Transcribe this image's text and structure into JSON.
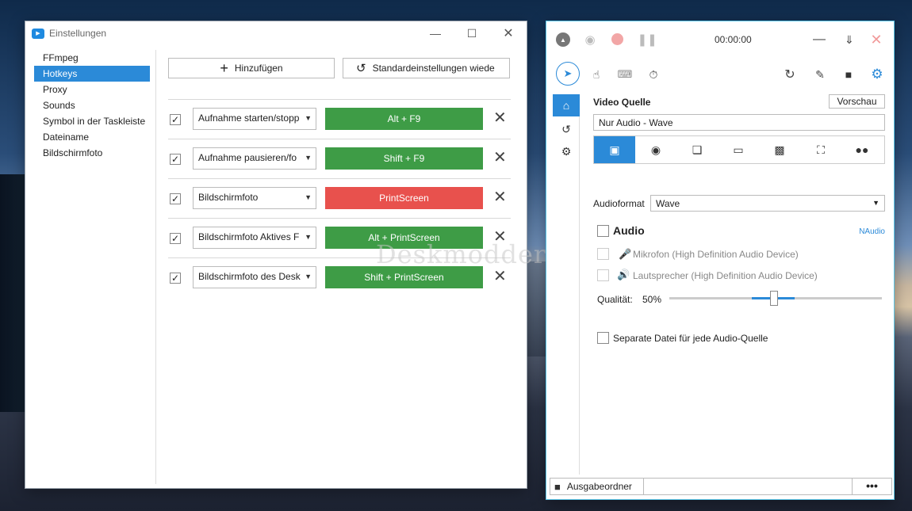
{
  "settings_window": {
    "title": "Einstellungen",
    "sidebar": [
      {
        "label": "FFmpeg"
      },
      {
        "label": "Hotkeys"
      },
      {
        "label": "Proxy"
      },
      {
        "label": "Sounds"
      },
      {
        "label": "Symbol in der Taskleiste"
      },
      {
        "label": "Dateiname"
      },
      {
        "label": "Bildschirmfoto"
      }
    ],
    "active_item": "Hotkeys",
    "add_button": "Hinzufügen",
    "defaults_button": "Standardeinstellungen wiede",
    "hotkeys": [
      {
        "action": "Aufnahme starten/stopp",
        "keys": "Alt + F9",
        "checked": true,
        "color": "#3e9c46"
      },
      {
        "action": "Aufnahme pausieren/fo",
        "keys": "Shift + F9",
        "checked": true,
        "color": "#3e9c46"
      },
      {
        "action": "Bildschirmfoto",
        "keys": "PrintScreen",
        "checked": true,
        "color": "#e8514d"
      },
      {
        "action": "Bildschirmfoto Aktives F",
        "keys": "Alt + PrintScreen",
        "checked": true,
        "color": "#3e9c46"
      },
      {
        "action": "Bildschirmfoto des Desk",
        "keys": "Shift + PrintScreen",
        "checked": true,
        "color": "#3e9c46"
      }
    ]
  },
  "watermark": "Deskmodder.de",
  "recorder_window": {
    "timer": "00:00:00",
    "video_source_label": "Video Quelle",
    "preview_button": "Vorschau",
    "video_source_value": "Nur Audio  -  Wave",
    "audioformat_label": "Audioformat",
    "audioformat_value": "Wave",
    "audio_label": "Audio",
    "naudio_link": "NAudio",
    "mic_label": "Mikrofon (High Definition Audio Device)",
    "speaker_label": "Lautsprecher (High Definition Audio Device)",
    "quality_label": "Qualität:",
    "quality_value": "50%",
    "quality_level": 0.5,
    "separate_file_label": "Separate Datei für jede Audio-Quelle",
    "output_folder_label": "Ausgabeordner",
    "more_button": "•••"
  },
  "colors": {
    "accent": "#2b8ad8",
    "hotkey_ok": "#3e9c46",
    "hotkey_conflict": "#e8514d"
  }
}
